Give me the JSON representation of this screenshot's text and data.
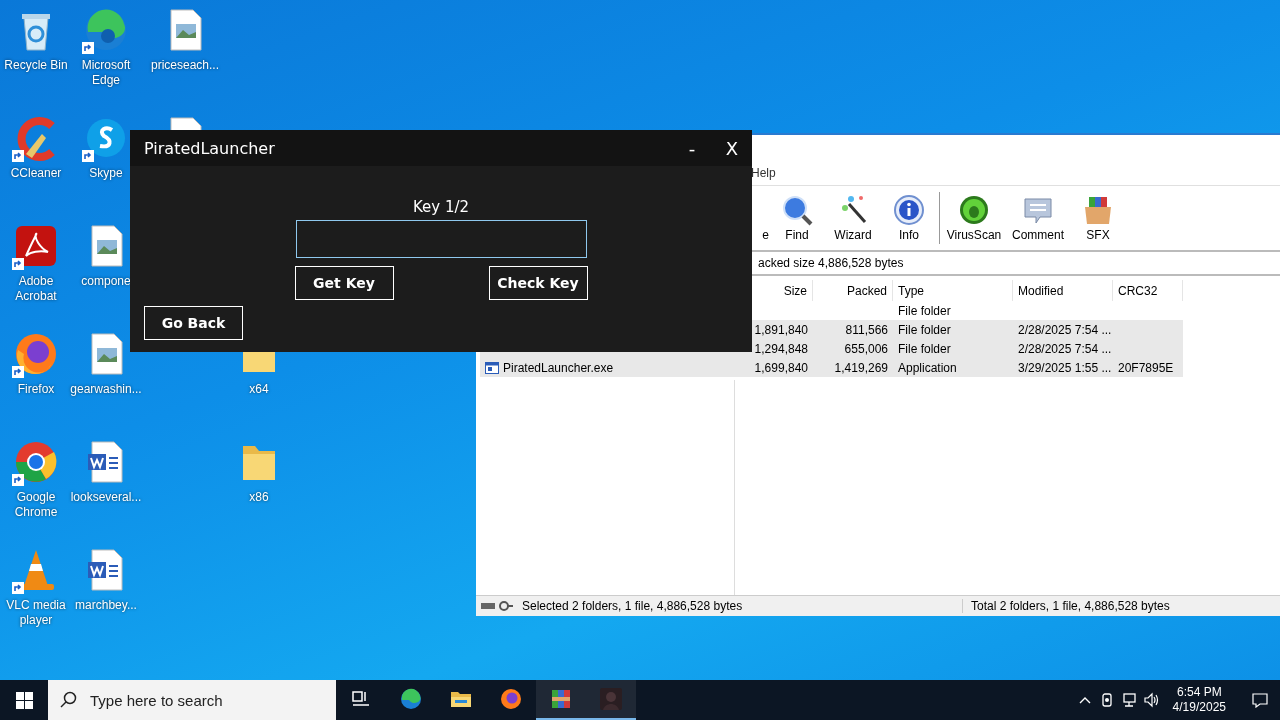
{
  "desktop_icons": [
    {
      "kind": "recycle",
      "label": "Recycle Bin"
    },
    {
      "kind": "edge",
      "label": "Microsoft Edge",
      "shortcut": true
    },
    {
      "kind": "image-file",
      "label": "priceseach..."
    },
    {
      "kind": "ccleaner",
      "label": "CCleaner",
      "shortcut": true
    },
    {
      "kind": "skype",
      "label": "Skype",
      "shortcut": true
    },
    {
      "kind": "word"
    },
    {
      "kind": "acrobat",
      "label": "Adobe Acrobat",
      "shortcut": true
    },
    {
      "kind": "image-file",
      "label": "compone"
    },
    {
      "kind": "firefox",
      "label": "Firefox",
      "shortcut": true
    },
    {
      "kind": "image-file",
      "label": "gearwashin..."
    },
    {
      "kind": "folder",
      "label": "x64"
    },
    {
      "kind": "chrome",
      "label": "Google Chrome",
      "shortcut": true
    },
    {
      "kind": "word",
      "label": "lookseveral..."
    },
    {
      "kind": "folder",
      "label": "x86"
    },
    {
      "kind": "vlc",
      "label": "VLC media player",
      "shortcut": true
    },
    {
      "kind": "word",
      "label": "marchbey..."
    }
  ],
  "archiver": {
    "menu": [
      "Help"
    ],
    "toolbar": [
      {
        "kind": "partial",
        "label": "e"
      },
      {
        "kind": "find",
        "label": "Find"
      },
      {
        "kind": "wizard",
        "label": "Wizard"
      },
      {
        "kind": "info",
        "label": "Info"
      },
      {
        "kind": "separator"
      },
      {
        "kind": "virusscan",
        "label": "VirusScan"
      },
      {
        "kind": "comment",
        "label": "Comment"
      },
      {
        "kind": "sfx",
        "label": "SFX"
      }
    ],
    "address": "acked size 4,886,528 bytes",
    "columns": [
      "Size",
      "Packed",
      "Type",
      "Modified",
      "CRC32"
    ],
    "rows": [
      {
        "selected": false,
        "cells": [
          "",
          "",
          "File folder",
          "",
          ""
        ]
      },
      {
        "selected": true,
        "cells": [
          "1,891,840",
          "811,566",
          "File folder",
          "2/28/2025 7:54 ...",
          ""
        ]
      },
      {
        "selected": true,
        "cells": [
          "1,294,848",
          "655,006",
          "File folder",
          "2/28/2025 7:54 ...",
          ""
        ]
      },
      {
        "selected": true,
        "kind": "exe",
        "name": "PiratedLauncher.exe",
        "cells": [
          "1,699,840",
          "1,419,269",
          "Application",
          "3/29/2025 1:55 ...",
          "20F7895E"
        ]
      }
    ],
    "status_left": "Selected 2 folders, 1 file, 4,886,528 bytes",
    "status_right": "Total 2 folders, 1 file, 4,886,528 bytes"
  },
  "dialog": {
    "title": "PiratedLauncher",
    "minimize": "-",
    "close": "X",
    "prompt": "Key 1/2",
    "buttons": [
      "Get Key",
      "Check Key"
    ],
    "back": "Go Back"
  },
  "taskbar": {
    "search": {
      "placeholder": "Type here to search"
    },
    "apps": [
      {
        "kind": "task-view",
        "active": false
      },
      {
        "kind": "edge",
        "active": false
      },
      {
        "kind": "explorer",
        "active": false
      },
      {
        "kind": "firefox",
        "active": false
      },
      {
        "kind": "winrar",
        "active": true
      },
      {
        "kind": "app",
        "active": true
      }
    ],
    "time": "6:54 PM",
    "date": "4/19/2025"
  }
}
